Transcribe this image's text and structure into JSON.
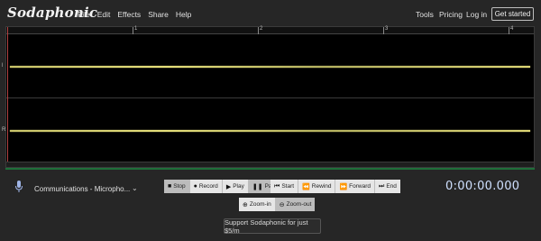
{
  "app": {
    "brand": "Sodaphonic"
  },
  "menu": {
    "left": [
      "File",
      "Edit",
      "Effects",
      "Share",
      "Help"
    ],
    "tools": "Tools",
    "pricing": "Pricing",
    "login": "Log in",
    "get_started": "Get started"
  },
  "ruler": {
    "labels": [
      "1",
      "2",
      "3",
      "4"
    ]
  },
  "tracks": {
    "label_top": "l",
    "label_bottom": "R"
  },
  "input": {
    "device": "Communications - Micropho...",
    "chevron": "⌄"
  },
  "transport": {
    "stop": "Stop",
    "record": "Record",
    "play": "Play",
    "pause": "Pause",
    "start": "Start",
    "rewind": "Rewind",
    "forward": "Forward",
    "end": "End",
    "zoom_in": "Zoom-in",
    "zoom_out": "Zoom-out"
  },
  "timer": {
    "value": "0:00:00.000"
  },
  "support": {
    "label": "Support Sodaphonic for just $5/m"
  },
  "colors": {
    "waveform": "#e5df7a",
    "background": "#262626",
    "timer": "#cfe0ff"
  }
}
